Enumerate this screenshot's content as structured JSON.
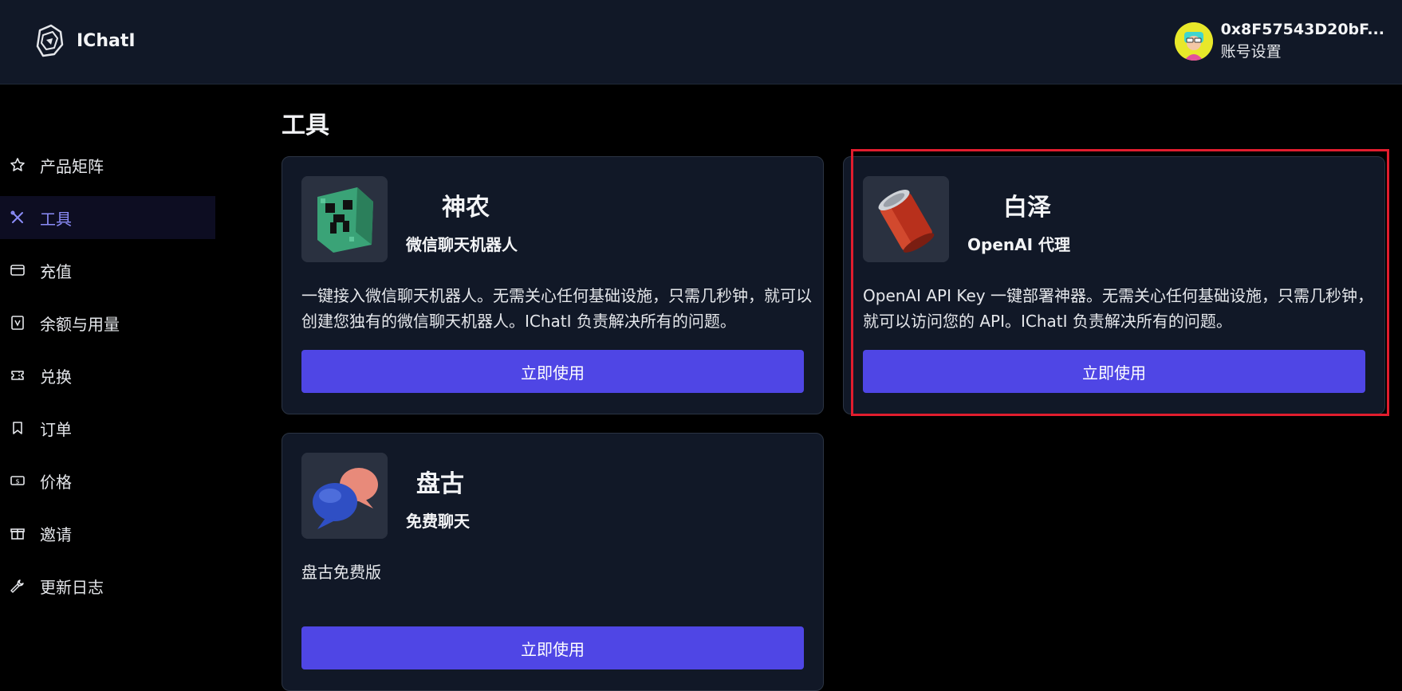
{
  "app": {
    "name": "IChatI"
  },
  "account": {
    "address": "0x8F57543D20bF...",
    "settings_label": "账号设置"
  },
  "sidebar": {
    "items": [
      {
        "label": "产品矩阵",
        "icon": "star-icon"
      },
      {
        "label": "工具",
        "icon": "tools-icon",
        "active": true
      },
      {
        "label": "充值",
        "icon": "credit-card-icon"
      },
      {
        "label": "余额与用量",
        "icon": "receipt-icon"
      },
      {
        "label": "兑换",
        "icon": "ticket-icon"
      },
      {
        "label": "订单",
        "icon": "bookmark-icon"
      },
      {
        "label": "价格",
        "icon": "banknote-icon"
      },
      {
        "label": "邀请",
        "icon": "gift-icon"
      },
      {
        "label": "更新日志",
        "icon": "wrench-icon"
      }
    ]
  },
  "main": {
    "title": "工具",
    "cards": [
      {
        "name": "神农",
        "subtitle": "微信聊天机器人",
        "description": "一键接入微信聊天机器人。无需关心任何基础设施，只需几秒钟，就可以创建您独有的微信聊天机器人。IChatI 负责解决所有的问题。",
        "button": "立即使用",
        "icon": "creeper-block-icon"
      },
      {
        "name": "白泽",
        "subtitle": "OpenAI 代理",
        "description": "OpenAI API Key 一键部署神器。无需关心任何基础设施，只需几秒钟，就可以访问您的 API。IChatI 负责解决所有的问题。",
        "button": "立即使用",
        "icon": "red-can-icon"
      },
      {
        "name": "盘古",
        "subtitle": "免费聊天",
        "description": "盘古免费版",
        "button": "立即使用",
        "icon": "chat-bubbles-icon"
      }
    ]
  },
  "colors": {
    "accent": "#4f46e5",
    "active_nav_text": "#8b8cf8",
    "card_bg": "#111827",
    "highlight": "#e11d2e"
  }
}
